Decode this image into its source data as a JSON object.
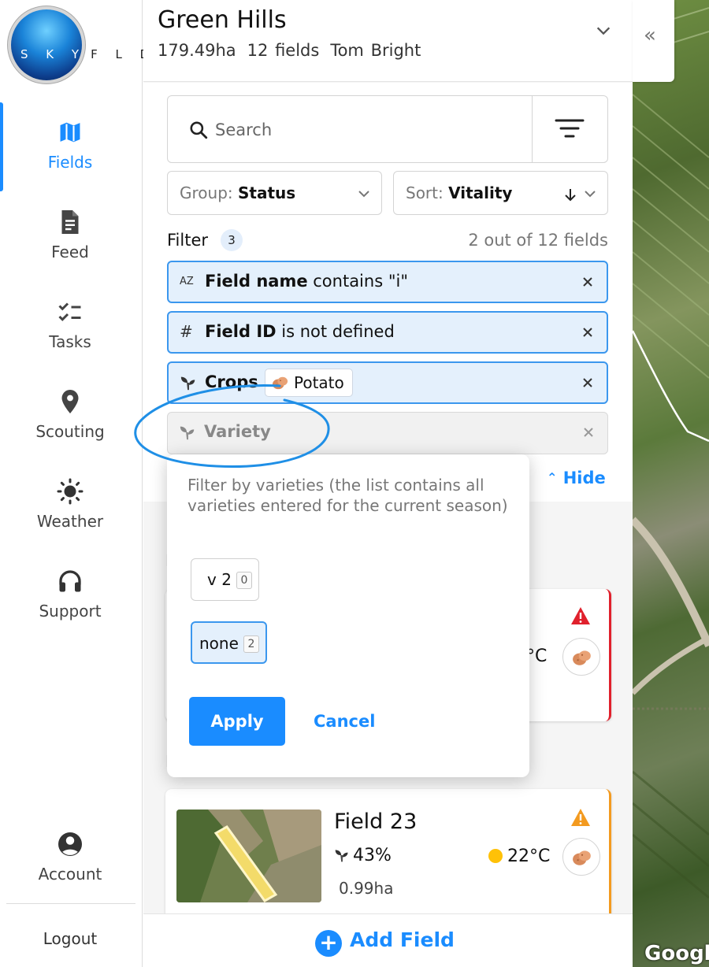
{
  "app": {
    "logo_text_light": "S K Y",
    "logo_text_dark": "F L D"
  },
  "sidebar": {
    "items": [
      {
        "label": "Fields",
        "icon": "map-icon",
        "active": true
      },
      {
        "label": "Feed",
        "icon": "document-icon"
      },
      {
        "label": "Tasks",
        "icon": "checklist-icon"
      },
      {
        "label": "Scouting",
        "icon": "location-pin-icon"
      },
      {
        "label": "Weather",
        "icon": "sun-icon"
      },
      {
        "label": "Support",
        "icon": "headset-icon"
      }
    ],
    "account_label": "Account",
    "logout_label": "Logout"
  },
  "header": {
    "farm_name": "Green Hills",
    "area": "179.49ha",
    "field_count": "12 fields",
    "owner": "Tom Bright"
  },
  "search": {
    "placeholder": "Search"
  },
  "group_select": {
    "prefix": "Group:",
    "value": "Status"
  },
  "sort_select": {
    "prefix": "Sort:",
    "value": "Vitality"
  },
  "filter": {
    "title": "Filter",
    "count": "3",
    "total": "2 out of 12 fields",
    "chips": [
      {
        "icon": "AZ",
        "field": "Field name",
        "rest": " contains \"i\""
      },
      {
        "icon": "#",
        "field": "Field ID",
        "rest": " is not defined"
      },
      {
        "icon": "sprout",
        "field": "Crops",
        "tag": "Potato"
      },
      {
        "icon": "sprout",
        "field": "Variety"
      }
    ],
    "hide_label": "Hide"
  },
  "popover": {
    "description": "Filter by varieties (the list contains all varieties entered for the current season)",
    "options": [
      {
        "label": "v 2",
        "count": "0",
        "selected": false
      },
      {
        "label": "none",
        "count": "2",
        "selected": true
      }
    ],
    "apply_label": "Apply",
    "cancel_label": "Cancel"
  },
  "cards": [
    {
      "temp_partial": "°C",
      "status_color": "#e0202c"
    },
    {
      "name": "Field 23",
      "vitality": "43%",
      "temp": "22°C",
      "area": "0.99ha",
      "status_color": "#f39a1f"
    }
  ],
  "add_field_label": "Add Field",
  "map": {
    "collapse_glyph": "«",
    "attribution": "Googl"
  }
}
